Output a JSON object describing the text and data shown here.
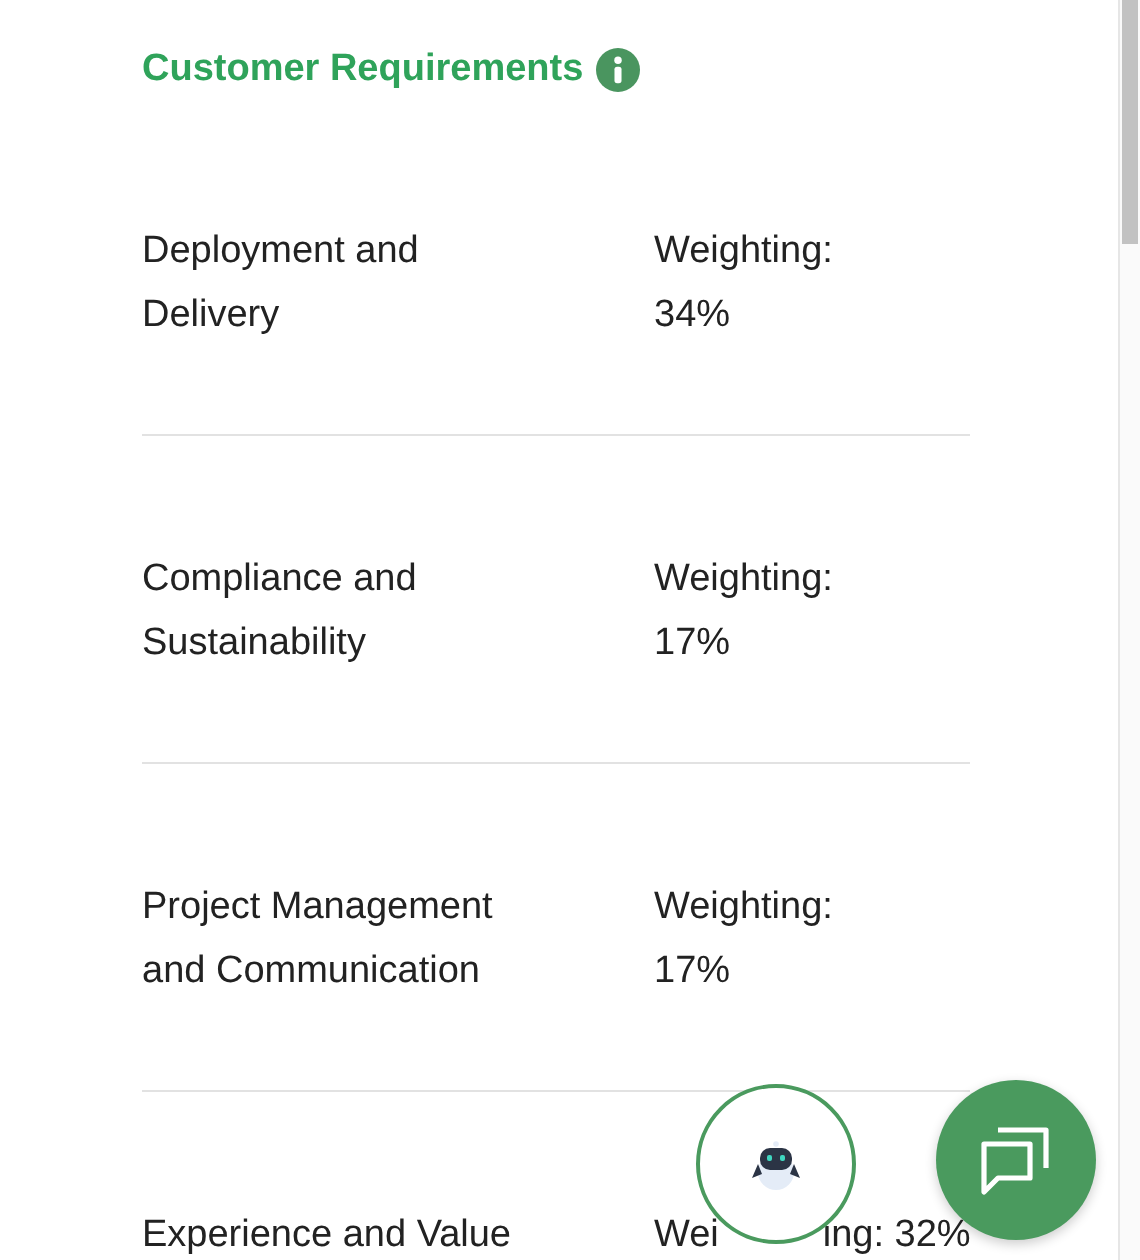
{
  "section": {
    "title": "Customer Requirements"
  },
  "requirements": [
    {
      "name": "Deployment and Delivery",
      "weighting": "Weighting: 34%"
    },
    {
      "name": "Compliance and Sustainability",
      "weighting": "Weighting: 17%"
    },
    {
      "name": "Project Management and Communication",
      "weighting": "Weighting: 17%"
    },
    {
      "name": "Experience and Value",
      "weighting": "Wei",
      "weighting_after_cover": "ing: 32%"
    }
  ]
}
